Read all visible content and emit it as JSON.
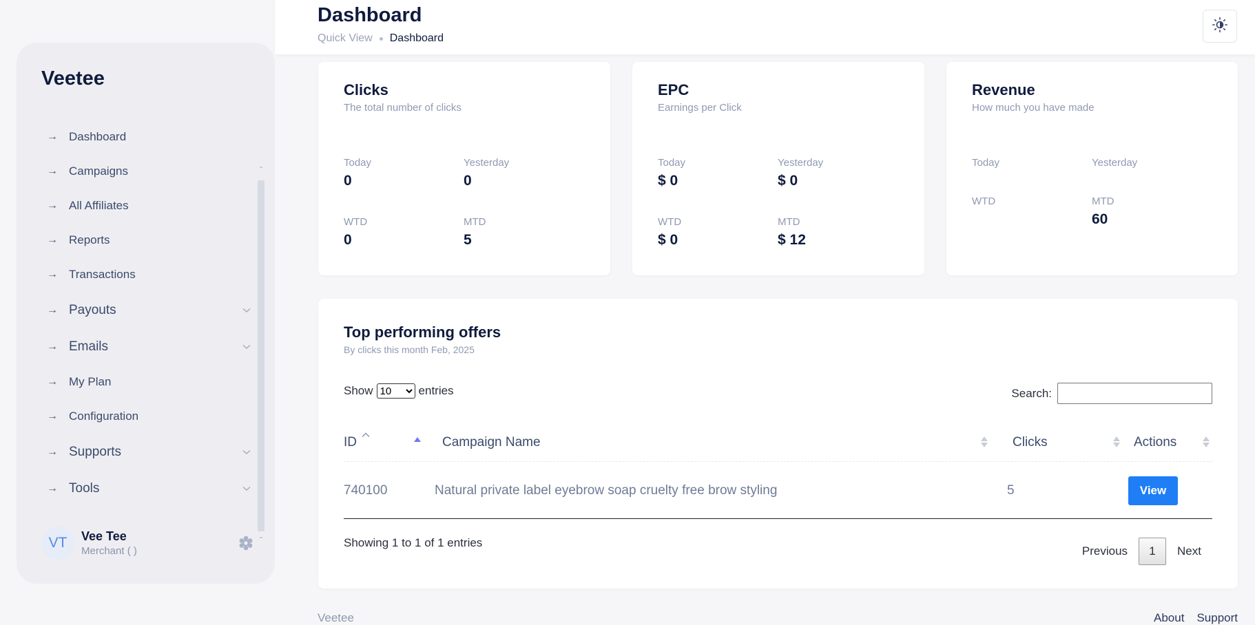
{
  "app": {
    "brand": "Veetee"
  },
  "header": {
    "title": "Dashboard",
    "breadcrumb": {
      "parent": "Quick View",
      "current": "Dashboard"
    },
    "theme_icon": "sun-icon"
  },
  "sidebar": {
    "items": [
      {
        "label": "Dashboard",
        "has_submenu": false
      },
      {
        "label": "Campaigns",
        "has_submenu": false
      },
      {
        "label": "All Affiliates",
        "has_submenu": false
      },
      {
        "label": "Reports",
        "has_submenu": false
      },
      {
        "label": "Transactions",
        "has_submenu": false
      },
      {
        "label": "Payouts",
        "has_submenu": true
      },
      {
        "label": "Emails",
        "has_submenu": true
      },
      {
        "label": "My Plan",
        "has_submenu": false
      },
      {
        "label": "Configuration",
        "has_submenu": false
      },
      {
        "label": "Supports",
        "has_submenu": true
      },
      {
        "label": "Tools",
        "has_submenu": true
      }
    ],
    "user": {
      "initials": "VT",
      "name": "Vee Tee",
      "role": "Merchant ( )"
    }
  },
  "stats": {
    "clicks": {
      "title": "Clicks",
      "subtitle": "The total number of clicks",
      "today_label": "Today",
      "today": "0",
      "yesterday_label": "Yesterday",
      "yesterday": "0",
      "wtd_label": "WTD",
      "wtd": "0",
      "mtd_label": "MTD",
      "mtd": "5"
    },
    "epc": {
      "title": "EPC",
      "subtitle": "Earnings per Click",
      "today_label": "Today",
      "today": "$ 0",
      "yesterday_label": "Yesterday",
      "yesterday": "$ 0",
      "wtd_label": "WTD",
      "wtd": "$ 0",
      "mtd_label": "MTD",
      "mtd": "$ 12"
    },
    "revenue": {
      "title": "Revenue",
      "subtitle": "How much you have made",
      "today_label": "Today",
      "today": "",
      "yesterday_label": "Yesterday",
      "yesterday": "",
      "wtd_label": "WTD",
      "wtd": "",
      "mtd_label": "MTD",
      "mtd": "60"
    }
  },
  "offers": {
    "title": "Top performing offers",
    "subtitle": "By clicks this month Feb, 2025",
    "show_label": "Show",
    "entries_label": "entries",
    "page_size": "10",
    "search_label": "Search:",
    "search_value": "",
    "columns": {
      "id": "ID",
      "campaign": "Campaign Name",
      "clicks": "Clicks",
      "actions": "Actions"
    },
    "rows": [
      {
        "id": "740100",
        "campaign": "Natural private label eyebrow soap cruelty free brow styling",
        "clicks": "5",
        "action": "View"
      }
    ],
    "info": "Showing 1 to 1 of 1 entries",
    "pagination": {
      "previous": "Previous",
      "page": "1",
      "next": "Next"
    }
  },
  "footer": {
    "brand": "Veetee",
    "links": [
      "About",
      "Support"
    ]
  },
  "colors": {
    "accent": "#1f7ef5",
    "sort_active": "#6b7cf0",
    "text_dark": "#0f1b3d"
  }
}
